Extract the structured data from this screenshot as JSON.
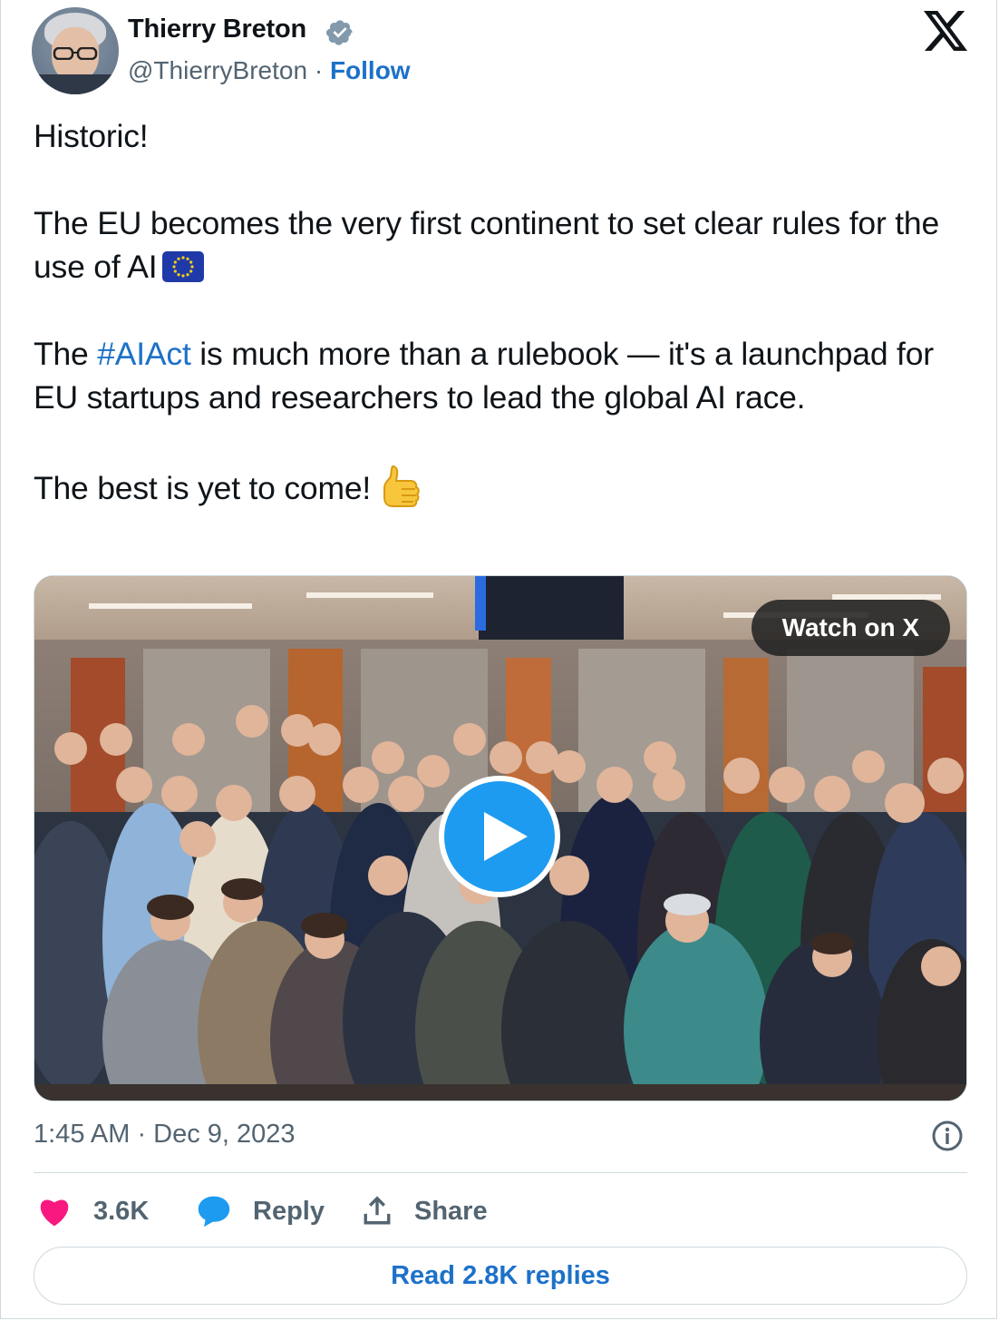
{
  "author": {
    "name": "Thierry Breton",
    "handle": "@ThierryBreton",
    "separator": "·",
    "follow_label": "Follow",
    "verified": true
  },
  "platform_logo": "x-logo-icon",
  "tweet": {
    "line1": "Historic!",
    "line2": "The EU becomes the very first continent to set clear rules for the use of AI",
    "line3_pre": "The ",
    "line3_hashtag": "#AIAct",
    "line3_post": " is much more than a rulebook — it's a launchpad for EU startups and researchers to lead the global AI race.",
    "line4": "The best is yet to come!",
    "emoji_flag": "eu-flag-icon",
    "emoji_thumb": "thumbs-up-icon"
  },
  "media": {
    "watch_label": "Watch on X",
    "play_icon": "play-icon"
  },
  "timestamp": "1:45 AM · Dec 9, 2023",
  "actions": {
    "like_count": "3.6K",
    "reply_label": "Reply",
    "share_label": "Share"
  },
  "read_replies_label": "Read 2.8K replies",
  "colors": {
    "link": "#1d71c8",
    "like": "#f91880",
    "reply_icon": "#1d9bf0",
    "secondary_text": "#536471",
    "border": "#cfd9de"
  }
}
